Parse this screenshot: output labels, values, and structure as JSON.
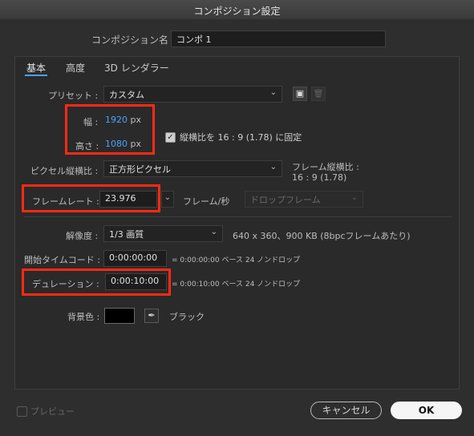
{
  "window": {
    "title": "コンポジション設定"
  },
  "composition_name": {
    "label": "コンポジション名 :",
    "value": "コンポ 1"
  },
  "tabs": [
    {
      "label": "基本"
    },
    {
      "label": "高度"
    },
    {
      "label": "3D レンダラー"
    }
  ],
  "preset": {
    "label": "プリセット :",
    "value": "カスタム"
  },
  "width": {
    "label": "幅 :",
    "value": "1920",
    "unit": "px"
  },
  "height": {
    "label": "高さ :",
    "value": "1080",
    "unit": "px"
  },
  "lock_aspect": {
    "checked": true,
    "label": "縦横比を 16 : 9 (1.78) に固定"
  },
  "pixel_aspect": {
    "label": "ピクセル縦横比 :",
    "value": "正方形ピクセル"
  },
  "frame_aspect": {
    "label": "フレーム縦横比 :",
    "value": "16 : 9 (1.78)"
  },
  "frame_rate": {
    "label": "フレームレート :",
    "value": "23.976",
    "unit": "フレーム/秒",
    "drop_frame": "ドロップフレーム"
  },
  "resolution": {
    "label": "解像度 :",
    "value": "1/3 画質",
    "info": "640 x 360、900 KB (8bpcフレームあたり)"
  },
  "start_timecode": {
    "label": "開始タイムコード :",
    "value": "0:00:00:00",
    "info": "= 0:00:00:00  ベース 24  ノンドロップ"
  },
  "duration": {
    "label": "デュレーション :",
    "value": "0:00:10:00",
    "info": "= 0:00:10:00  ベース 24  ノンドロップ"
  },
  "background": {
    "label": "背景色 :",
    "color": "#000000",
    "name": "ブラック"
  },
  "preview": {
    "label": "プレビュー",
    "checked": false
  },
  "buttons": {
    "cancel": "キャンセル",
    "ok": "OK"
  },
  "colors": {
    "accent": "#4aa3ff",
    "highlight": "#ff2a12"
  }
}
